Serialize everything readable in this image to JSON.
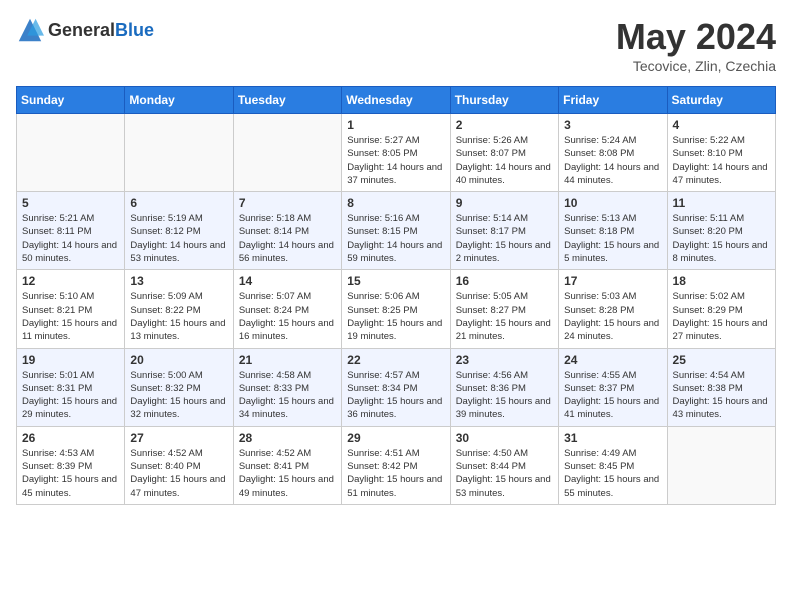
{
  "header": {
    "logo_general": "General",
    "logo_blue": "Blue",
    "title": "May 2024",
    "location": "Tecovice, Zlin, Czechia"
  },
  "days_of_week": [
    "Sunday",
    "Monday",
    "Tuesday",
    "Wednesday",
    "Thursday",
    "Friday",
    "Saturday"
  ],
  "weeks": [
    [
      {
        "day": "",
        "info": ""
      },
      {
        "day": "",
        "info": ""
      },
      {
        "day": "",
        "info": ""
      },
      {
        "day": "1",
        "info": "Sunrise: 5:27 AM\nSunset: 8:05 PM\nDaylight: 14 hours and 37 minutes."
      },
      {
        "day": "2",
        "info": "Sunrise: 5:26 AM\nSunset: 8:07 PM\nDaylight: 14 hours and 40 minutes."
      },
      {
        "day": "3",
        "info": "Sunrise: 5:24 AM\nSunset: 8:08 PM\nDaylight: 14 hours and 44 minutes."
      },
      {
        "day": "4",
        "info": "Sunrise: 5:22 AM\nSunset: 8:10 PM\nDaylight: 14 hours and 47 minutes."
      }
    ],
    [
      {
        "day": "5",
        "info": "Sunrise: 5:21 AM\nSunset: 8:11 PM\nDaylight: 14 hours and 50 minutes."
      },
      {
        "day": "6",
        "info": "Sunrise: 5:19 AM\nSunset: 8:12 PM\nDaylight: 14 hours and 53 minutes."
      },
      {
        "day": "7",
        "info": "Sunrise: 5:18 AM\nSunset: 8:14 PM\nDaylight: 14 hours and 56 minutes."
      },
      {
        "day": "8",
        "info": "Sunrise: 5:16 AM\nSunset: 8:15 PM\nDaylight: 14 hours and 59 minutes."
      },
      {
        "day": "9",
        "info": "Sunrise: 5:14 AM\nSunset: 8:17 PM\nDaylight: 15 hours and 2 minutes."
      },
      {
        "day": "10",
        "info": "Sunrise: 5:13 AM\nSunset: 8:18 PM\nDaylight: 15 hours and 5 minutes."
      },
      {
        "day": "11",
        "info": "Sunrise: 5:11 AM\nSunset: 8:20 PM\nDaylight: 15 hours and 8 minutes."
      }
    ],
    [
      {
        "day": "12",
        "info": "Sunrise: 5:10 AM\nSunset: 8:21 PM\nDaylight: 15 hours and 11 minutes."
      },
      {
        "day": "13",
        "info": "Sunrise: 5:09 AM\nSunset: 8:22 PM\nDaylight: 15 hours and 13 minutes."
      },
      {
        "day": "14",
        "info": "Sunrise: 5:07 AM\nSunset: 8:24 PM\nDaylight: 15 hours and 16 minutes."
      },
      {
        "day": "15",
        "info": "Sunrise: 5:06 AM\nSunset: 8:25 PM\nDaylight: 15 hours and 19 minutes."
      },
      {
        "day": "16",
        "info": "Sunrise: 5:05 AM\nSunset: 8:27 PM\nDaylight: 15 hours and 21 minutes."
      },
      {
        "day": "17",
        "info": "Sunrise: 5:03 AM\nSunset: 8:28 PM\nDaylight: 15 hours and 24 minutes."
      },
      {
        "day": "18",
        "info": "Sunrise: 5:02 AM\nSunset: 8:29 PM\nDaylight: 15 hours and 27 minutes."
      }
    ],
    [
      {
        "day": "19",
        "info": "Sunrise: 5:01 AM\nSunset: 8:31 PM\nDaylight: 15 hours and 29 minutes."
      },
      {
        "day": "20",
        "info": "Sunrise: 5:00 AM\nSunset: 8:32 PM\nDaylight: 15 hours and 32 minutes."
      },
      {
        "day": "21",
        "info": "Sunrise: 4:58 AM\nSunset: 8:33 PM\nDaylight: 15 hours and 34 minutes."
      },
      {
        "day": "22",
        "info": "Sunrise: 4:57 AM\nSunset: 8:34 PM\nDaylight: 15 hours and 36 minutes."
      },
      {
        "day": "23",
        "info": "Sunrise: 4:56 AM\nSunset: 8:36 PM\nDaylight: 15 hours and 39 minutes."
      },
      {
        "day": "24",
        "info": "Sunrise: 4:55 AM\nSunset: 8:37 PM\nDaylight: 15 hours and 41 minutes."
      },
      {
        "day": "25",
        "info": "Sunrise: 4:54 AM\nSunset: 8:38 PM\nDaylight: 15 hours and 43 minutes."
      }
    ],
    [
      {
        "day": "26",
        "info": "Sunrise: 4:53 AM\nSunset: 8:39 PM\nDaylight: 15 hours and 45 minutes."
      },
      {
        "day": "27",
        "info": "Sunrise: 4:52 AM\nSunset: 8:40 PM\nDaylight: 15 hours and 47 minutes."
      },
      {
        "day": "28",
        "info": "Sunrise: 4:52 AM\nSunset: 8:41 PM\nDaylight: 15 hours and 49 minutes."
      },
      {
        "day": "29",
        "info": "Sunrise: 4:51 AM\nSunset: 8:42 PM\nDaylight: 15 hours and 51 minutes."
      },
      {
        "day": "30",
        "info": "Sunrise: 4:50 AM\nSunset: 8:44 PM\nDaylight: 15 hours and 53 minutes."
      },
      {
        "day": "31",
        "info": "Sunrise: 4:49 AM\nSunset: 8:45 PM\nDaylight: 15 hours and 55 minutes."
      },
      {
        "day": "",
        "info": ""
      }
    ]
  ]
}
